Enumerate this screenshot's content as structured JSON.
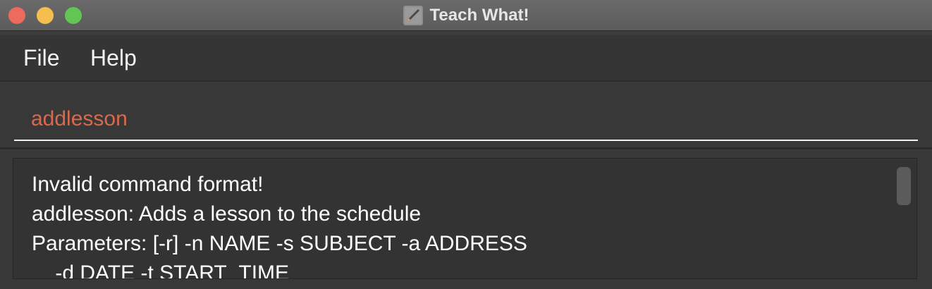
{
  "window": {
    "title": "Teach What!",
    "icon": "app-notepad-icon"
  },
  "menu": {
    "file": "File",
    "help": "Help"
  },
  "command": {
    "value": "addlesson"
  },
  "result": {
    "lines": [
      "Invalid command format!",
      "addlesson: Adds a lesson to the schedule",
      "Parameters: [-r] -n NAME -s SUBJECT -a ADDRESS",
      "    -d DATE -t START_TIME"
    ]
  },
  "colors": {
    "command_text": "#d9694d",
    "traffic_close": "#ed6a5e",
    "traffic_minimize": "#f5bf4f",
    "traffic_maximize": "#62c554"
  }
}
